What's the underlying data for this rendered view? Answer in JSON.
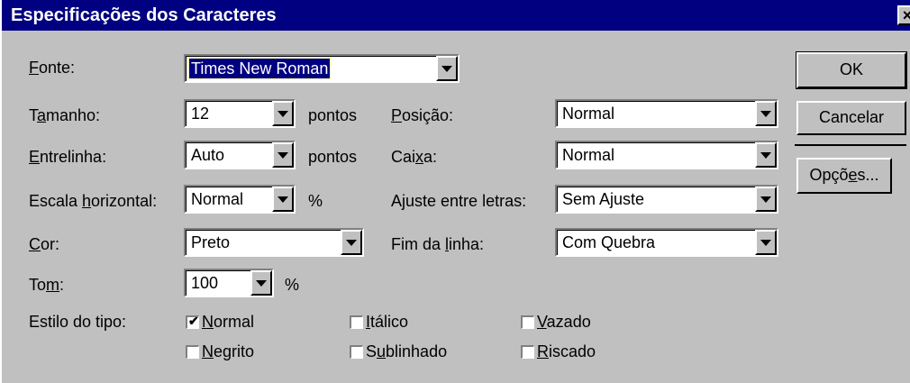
{
  "dialog": {
    "title": "Especificações dos Caracteres",
    "close_label": "×"
  },
  "fields": {
    "fonte": {
      "label_u": "F",
      "label_rest": "onte:",
      "value": "Times New Roman"
    },
    "tamanho": {
      "label_pre": "T",
      "label_u": "a",
      "label_rest": "manho:",
      "value": "12",
      "unit": "pontos"
    },
    "entrelinha": {
      "label_u": "E",
      "label_rest": "ntrelinha:",
      "value": "Auto",
      "unit": "pontos"
    },
    "escala": {
      "label_pre": "Escala ",
      "label_u": "h",
      "label_rest": "orizontal:",
      "value": "Normal",
      "unit": "%"
    },
    "cor": {
      "label_u": "C",
      "label_rest": "or:",
      "value": "Preto"
    },
    "tom": {
      "label_pre": "To",
      "label_u": "m",
      "label_rest": ":",
      "value": "100",
      "unit": "%"
    },
    "posicao": {
      "label_u": "P",
      "label_rest": "osição:",
      "value": "Normal"
    },
    "caixa": {
      "label_pre": "Cai",
      "label_u": "x",
      "label_rest": "a:",
      "value": "Normal"
    },
    "ajuste": {
      "label_pre": "A",
      "label_u": "j",
      "label_rest": "uste entre letras:",
      "value": "Sem Ajuste"
    },
    "fim": {
      "label_pre": "Fim da ",
      "label_u": "l",
      "label_rest": "inha:",
      "value": "Com Quebra"
    }
  },
  "style": {
    "label": "Estilo do tipo:",
    "options": [
      {
        "pre": "",
        "u": "N",
        "rest": "ormal",
        "checked": true
      },
      {
        "pre": "",
        "u": "I",
        "rest": "tálico",
        "checked": false
      },
      {
        "pre": "",
        "u": "V",
        "rest": "azado",
        "checked": false
      },
      {
        "pre": "",
        "u": "N",
        "rest": "egrito",
        "checked": false
      },
      {
        "pre": "S",
        "u": "u",
        "rest": "blinhado",
        "checked": false
      },
      {
        "pre": "",
        "u": "R",
        "rest": "iscado",
        "checked": false
      }
    ],
    "check_glyph": "✔"
  },
  "buttons": {
    "ok": "OK",
    "cancel": "Cancelar",
    "options_pre": "Opçõ",
    "options_u": "e",
    "options_rest": "s..."
  },
  "colors": {
    "titlebar": "#000080",
    "face": "#c0c0c0",
    "selection": "#000080"
  }
}
